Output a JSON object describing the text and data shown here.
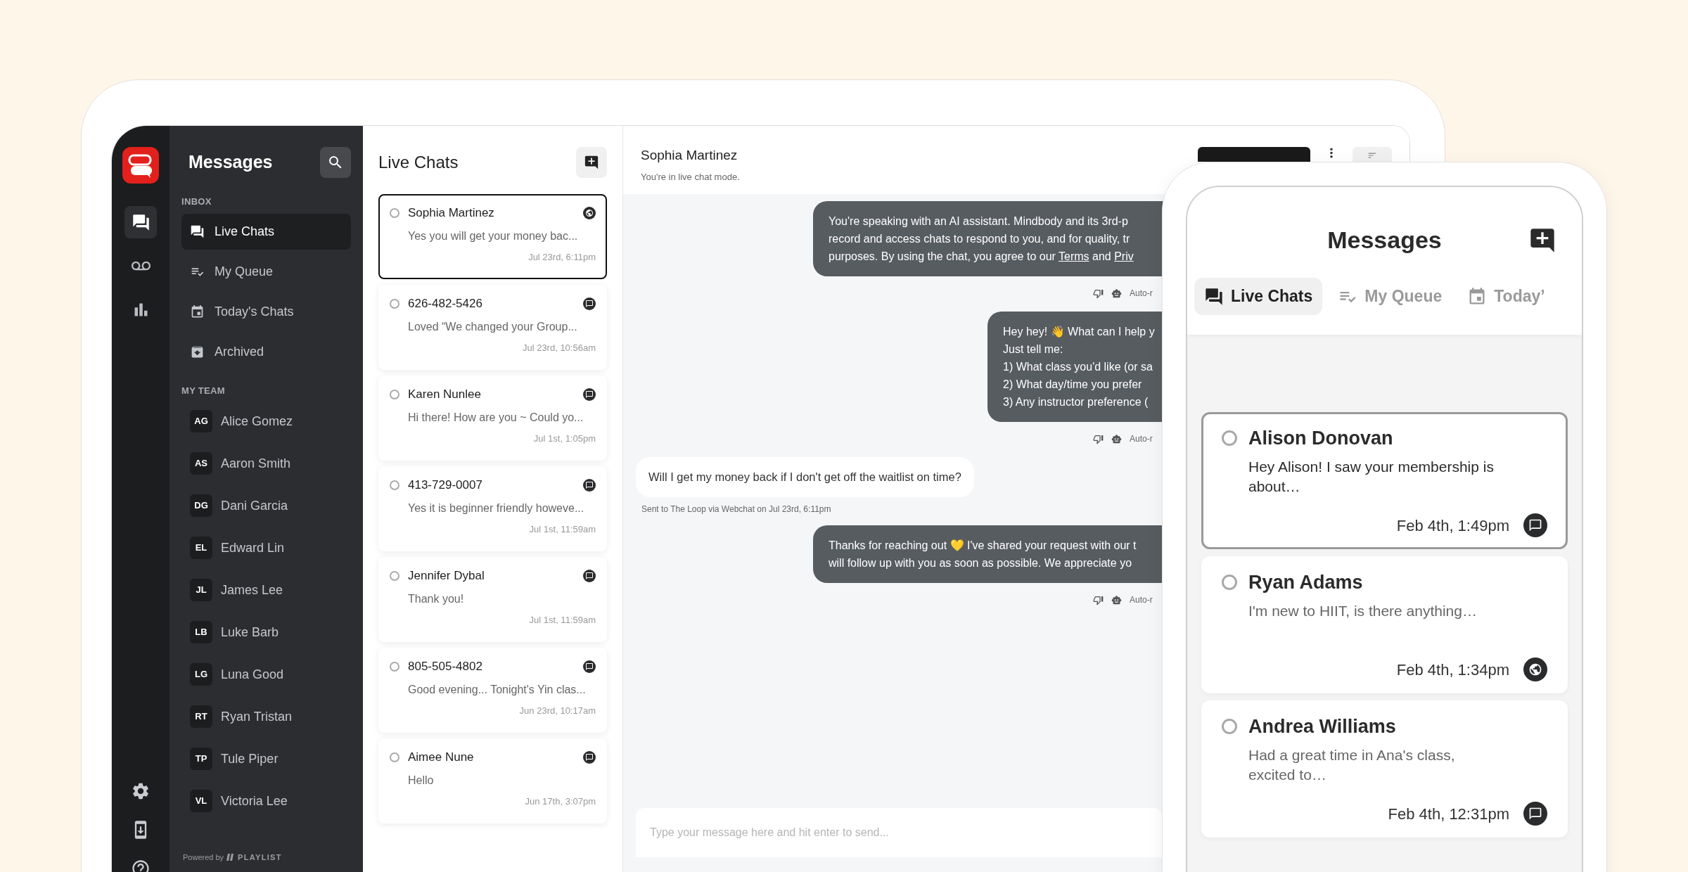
{
  "rail": {
    "items": [
      {
        "selected": true
      },
      {
        "selected": false
      },
      {
        "selected": false
      }
    ]
  },
  "nav": {
    "title": "Messages",
    "inbox_label": "INBOX",
    "inbox": [
      {
        "label": "Live Chats",
        "selected": true
      },
      {
        "label": "My Queue",
        "selected": false
      },
      {
        "label": "Today's Chats",
        "selected": false
      },
      {
        "label": "Archived",
        "selected": false
      }
    ],
    "team_label": "MY TEAM",
    "team": [
      {
        "initials": "AG",
        "name": "Alice Gomez"
      },
      {
        "initials": "AS",
        "name": "Aaron Smith"
      },
      {
        "initials": "DG",
        "name": "Dani Garcia"
      },
      {
        "initials": "EL",
        "name": "Edward Lin"
      },
      {
        "initials": "JL",
        "name": "James Lee"
      },
      {
        "initials": "LB",
        "name": "Luke Barb"
      },
      {
        "initials": "LG",
        "name": "Luna Good"
      },
      {
        "initials": "RT",
        "name": "Ryan Tristan"
      },
      {
        "initials": "TP",
        "name": "Tule Piper"
      },
      {
        "initials": "VL",
        "name": "Victoria Lee"
      }
    ],
    "footer": {
      "powered": "Powered by",
      "brand": "PLAYLIST"
    }
  },
  "chat_list": {
    "title": "Live Chats",
    "conversations": [
      {
        "name": "Sophia Martinez",
        "preview": "Yes you will get your money bac...",
        "time": "Jul 23rd, 6:11pm",
        "kind": "web",
        "selected": true
      },
      {
        "name": "626-482-5426",
        "preview": "Loved “We changed your Group...",
        "time": "Jul 23rd, 10:56am",
        "kind": "sms",
        "selected": false
      },
      {
        "name": "Karen Nunlee",
        "preview": "Hi there! How are you ~ Could yo...",
        "time": "Jul 1st, 1:05pm",
        "kind": "sms",
        "selected": false
      },
      {
        "name": "413-729-0007",
        "preview": "Yes it is beginner friendly howeve...",
        "time": "Jul 1st, 11:59am",
        "kind": "sms",
        "selected": false
      },
      {
        "name": "Jennifer Dybal",
        "preview": "Thank you!",
        "time": "Jul 1st, 11:59am",
        "kind": "sms",
        "selected": false
      },
      {
        "name": "805-505-4802",
        "preview": "Good evening... Tonight's Yin clas...",
        "time": "Jun 23rd, 10:17am",
        "kind": "sms",
        "selected": false
      },
      {
        "name": "Aimee Nune",
        "preview": "Hello",
        "time": "Jun 17th, 3:07pm",
        "kind": "sms",
        "selected": false
      }
    ]
  },
  "conversation": {
    "name": "Sophia Martinez",
    "status": "You're in live chat mode.",
    "messages": [
      {
        "kind": "outgoing",
        "lines": [
          "You're speaking with an AI assistant. Mindbody and its 3rd-p",
          "record and access chats to respond to you, and for quality, tr",
          {
            "parts": [
              {
                "text": "purposes. By using the chat, you agree to our ",
                "link": false
              },
              {
                "text": "Terms",
                "link": true
              },
              {
                "text": " and ",
                "link": false
              },
              {
                "text": "Priv",
                "link": true
              }
            ]
          }
        ],
        "meta": "Auto-r"
      },
      {
        "kind": "outgoing",
        "lines": [
          "Hey hey! 👋 What can I help y",
          "Just tell me:",
          "1) What class you'd like (or sa",
          "2) What day/time you prefer",
          "3) Any instructor preference ("
        ],
        "meta": "Auto-r"
      },
      {
        "kind": "incoming",
        "lines": [
          "Will I get my money back if I don't get off the waitlist on time?"
        ],
        "caption": "Sent to The Loop via Webchat on Jul 23rd, 6:11pm"
      },
      {
        "kind": "outgoing",
        "lines": [
          "Thanks for reaching out 💛 I've shared your request with our t",
          "will follow up with you as soon as possible. We appreciate yo"
        ],
        "meta": "Auto-r"
      }
    ],
    "composer": {
      "placeholder": "Type your message here and hit enter to send..."
    }
  },
  "phone": {
    "title": "Messages",
    "tabs": [
      {
        "label": "Live Chats",
        "selected": true
      },
      {
        "label": "My Queue",
        "selected": false
      },
      {
        "label": "Today’",
        "selected": false
      }
    ],
    "cards": [
      {
        "name": "Alison Donovan",
        "preview": "Hey Alison! I saw your membership is about…",
        "time": "Feb 4th, 1:49pm",
        "kind": "sms",
        "selected": true
      },
      {
        "name": "Ryan Adams",
        "preview": "I'm new to HIIT, is there anything…",
        "time": "Feb 4th, 1:34pm",
        "kind": "web",
        "selected": false
      },
      {
        "name": "Andrea Williams",
        "preview": "Had a great time in Ana's class, excited to…",
        "time": "Feb 4th, 12:31pm",
        "kind": "sms",
        "selected": false
      }
    ]
  }
}
